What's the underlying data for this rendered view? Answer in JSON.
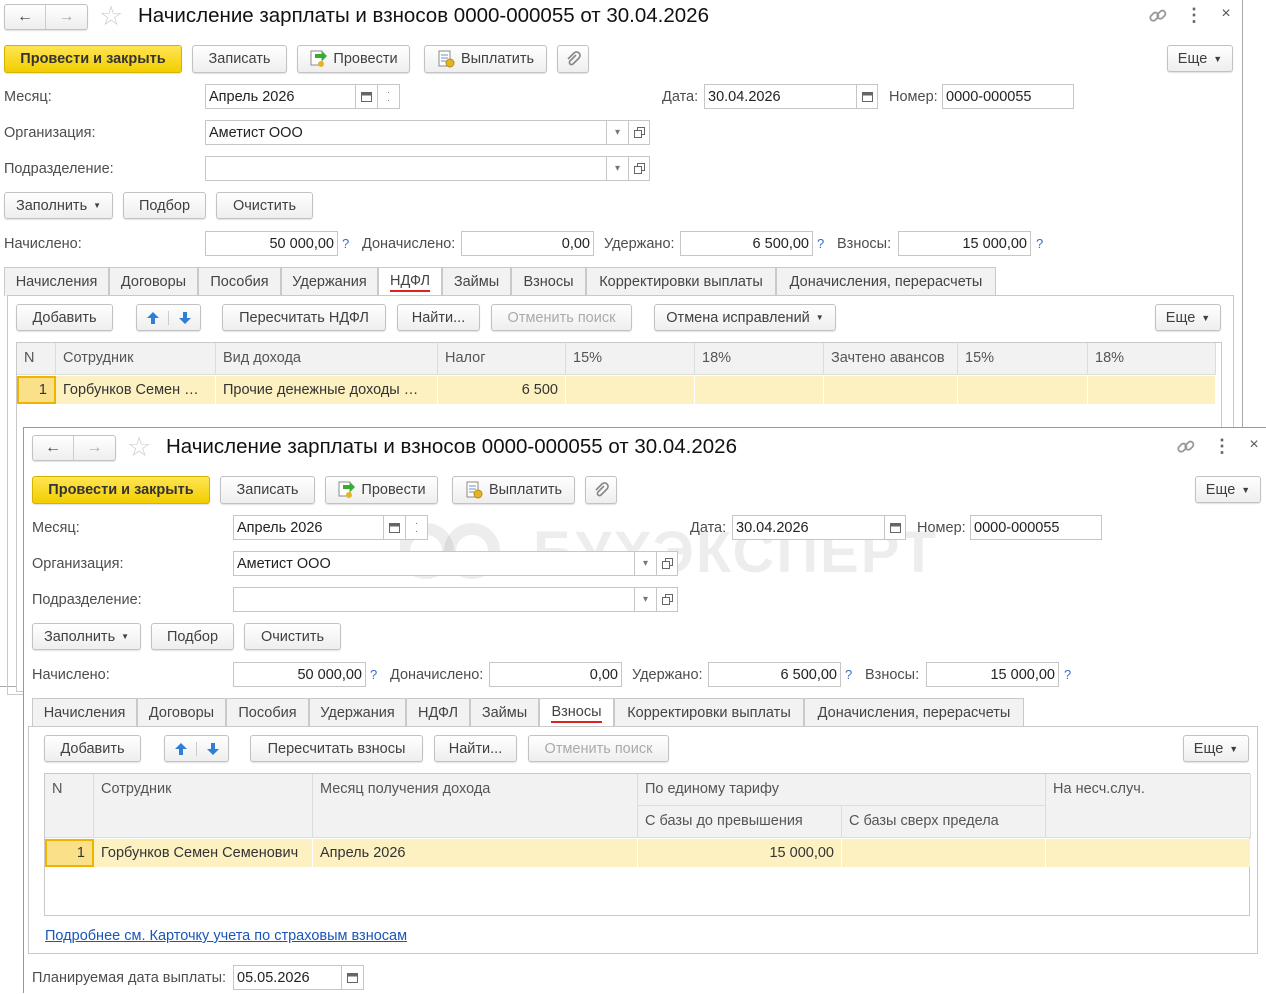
{
  "watermark": "БУХЭКСПЕРТ",
  "windows": [
    {
      "title": "Начисление зарплаты и взносов 0000-000055 от 30.04.2026",
      "toolbar": {
        "post_close": "Провести и закрыть",
        "save": "Записать",
        "post": "Провести",
        "pay": "Выплатить",
        "more": "Еще"
      },
      "fields": {
        "month_label": "Месяц:",
        "month": "Апрель 2026",
        "date_label": "Дата:",
        "date": "30.04.2026",
        "number_label": "Номер:",
        "number": "0000-000055",
        "org_label": "Организация:",
        "org": "Аметист ООО",
        "dept_label": "Подразделение:",
        "dept": ""
      },
      "actions": {
        "fill": "Заполнить",
        "select": "Подбор",
        "clear": "Очистить"
      },
      "totals": {
        "accrued_label": "Начислено:",
        "accrued": "50 000,00",
        "extra_label": "Доначислено:",
        "extra": "0,00",
        "withheld_label": "Удержано:",
        "withheld": "6 500,00",
        "contrib_label": "Взносы:",
        "contrib": "15 000,00",
        "help": "?"
      },
      "tabs": [
        "Начисления",
        "Договоры",
        "Пособия",
        "Удержания",
        "НДФЛ",
        "Займы",
        "Взносы",
        "Корректировки выплаты",
        "Доначисления, перерасчеты"
      ],
      "active_tab": "НДФЛ",
      "tab_toolbar": {
        "add": "Добавить",
        "recalc": "Пересчитать НДФЛ",
        "find": "Найти...",
        "cancel_find": "Отменить поиск",
        "undo_fix": "Отмена исправлений",
        "more": "Еще"
      },
      "table": {
        "columns": [
          "N",
          "Сотрудник",
          "Вид дохода",
          "Налог",
          "15%",
          "18%",
          "Зачтено авансов",
          "15%",
          "18%"
        ],
        "rows": [
          [
            "1",
            "Горбунков Семен …",
            "Прочие денежные доходы …",
            "6 500",
            "",
            "",
            "",
            "",
            ""
          ]
        ]
      }
    },
    {
      "title": "Начисление зарплаты и взносов 0000-000055 от 30.04.2026",
      "toolbar": {
        "post_close": "Провести и закрыть",
        "save": "Записать",
        "post": "Провести",
        "pay": "Выплатить",
        "more": "Еще"
      },
      "fields": {
        "month_label": "Месяц:",
        "month": "Апрель 2026",
        "date_label": "Дата:",
        "date": "30.04.2026",
        "number_label": "Номер:",
        "number": "0000-000055",
        "org_label": "Организация:",
        "org": "Аметист ООО",
        "dept_label": "Подразделение:",
        "dept": ""
      },
      "actions": {
        "fill": "Заполнить",
        "select": "Подбор",
        "clear": "Очистить"
      },
      "totals": {
        "accrued_label": "Начислено:",
        "accrued": "50 000,00",
        "extra_label": "Доначислено:",
        "extra": "0,00",
        "withheld_label": "Удержано:",
        "withheld": "6 500,00",
        "contrib_label": "Взносы:",
        "contrib": "15 000,00",
        "help": "?"
      },
      "tabs": [
        "Начисления",
        "Договоры",
        "Пособия",
        "Удержания",
        "НДФЛ",
        "Займы",
        "Взносы",
        "Корректировки выплаты",
        "Доначисления, перерасчеты"
      ],
      "active_tab": "Взносы",
      "tab_toolbar": {
        "add": "Добавить",
        "recalc": "Пересчитать взносы",
        "find": "Найти...",
        "cancel_find": "Отменить поиск",
        "more": "Еще"
      },
      "table": {
        "columns": [
          "N",
          "Сотрудник",
          "Месяц получения дохода",
          "По единому тарифу",
          "На несч.случ."
        ],
        "subcolumns": [
          "С базы до превышения",
          "С базы сверх предела"
        ],
        "rows": [
          [
            "1",
            "Горбунков Семен Семенович",
            "Апрель 2026",
            "15 000,00",
            "",
            ""
          ]
        ]
      },
      "card_link": "Подробнее см. Карточку учета по страховым взносам",
      "planned_date_label": "Планируемая дата выплаты:",
      "planned_date": "05.05.2026"
    }
  ]
}
